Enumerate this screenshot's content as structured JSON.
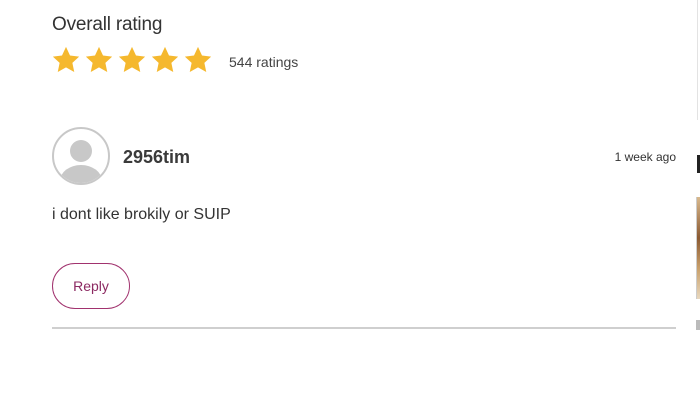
{
  "rating": {
    "heading": "Overall rating",
    "stars_filled": 5,
    "stars_total": 5,
    "star_color": "#f5b82e",
    "count_label": "544 ratings"
  },
  "comment": {
    "username": "2956tim",
    "timestamp": "1 week ago",
    "text": "i dont like brokily or SUIP",
    "avatar_icon": "default-user-avatar-icon",
    "reply_label": "Reply"
  },
  "colors": {
    "accent": "#a1326e",
    "divider": "#cfcfcf",
    "avatar_gray": "#c8c8c8"
  }
}
